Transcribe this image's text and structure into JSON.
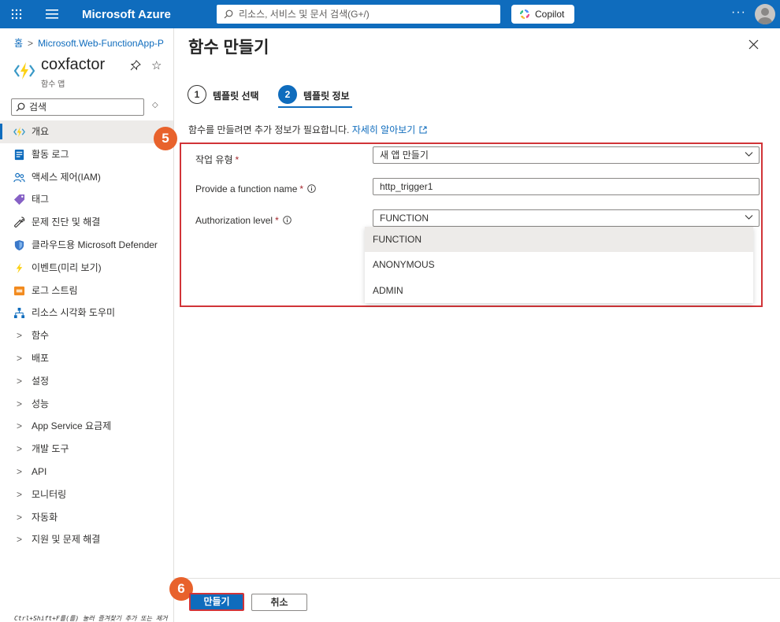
{
  "topbar": {
    "brand": "Microsoft Azure",
    "search_placeholder": "리소스, 서비스 및 문서 검색(G+/)",
    "copilot_label": "Copilot",
    "more_label": "···"
  },
  "sidebar": {
    "breadcrumb_home": "홈",
    "breadcrumb_resource": "Microsoft.Web-FunctionApp-P",
    "resource_name": "coxfactor",
    "resource_type": "함수 앱",
    "search_placeholder": "검색",
    "items": [
      {
        "label": "개요",
        "icon": "function-app-icon",
        "active": true
      },
      {
        "label": "활동 로그",
        "icon": "activity-log-icon"
      },
      {
        "label": "액세스 제어(IAM)",
        "icon": "people-icon"
      },
      {
        "label": "태그",
        "icon": "tag-icon"
      },
      {
        "label": "문제 진단 및 해결",
        "icon": "wrench-icon"
      },
      {
        "label": "클라우드용 Microsoft Defender",
        "icon": "shield-icon"
      },
      {
        "label": "이벤트(미리 보기)",
        "icon": "lightning-icon"
      },
      {
        "label": "로그 스트림",
        "icon": "log-stream-icon"
      },
      {
        "label": "리소스 시각화 도우미",
        "icon": "network-icon"
      },
      {
        "label": "함수",
        "chevron": true
      },
      {
        "label": "배포",
        "chevron": true
      },
      {
        "label": "설정",
        "chevron": true
      },
      {
        "label": "성능",
        "chevron": true
      },
      {
        "label": "App Service 요금제",
        "chevron": true
      },
      {
        "label": "개발 도구",
        "chevron": true
      },
      {
        "label": "API",
        "chevron": true
      },
      {
        "label": "모니터링",
        "chevron": true
      },
      {
        "label": "자동화",
        "chevron": true
      },
      {
        "label": "지원 및 문제 해결",
        "chevron": true
      }
    ],
    "footer_hint": "Ctrl+Shift+F를(를) 눌러 즐겨찾기 추가 또는 제거"
  },
  "panel": {
    "title": "함수 만들기",
    "steps": [
      {
        "num": "1",
        "label": "템플릿 선택"
      },
      {
        "num": "2",
        "label": "템플릿 정보"
      }
    ],
    "info_text": "함수를 만들려면 추가 정보가 필요합니다.",
    "info_link": "자세히 알아보기",
    "callout_5": "5",
    "callout_6": "6",
    "fields": {
      "task_type_label": "작업 유형",
      "task_type_value": "새 앱 만들기",
      "function_name_label": "Provide a function name",
      "function_name_value": "http_trigger1",
      "auth_level_label": "Authorization level",
      "auth_level_value": "FUNCTION",
      "required_mark": "*"
    },
    "auth_options": [
      "FUNCTION",
      "ANONYMOUS",
      "ADMIN"
    ],
    "create_button": "만들기",
    "cancel_button": "취소"
  },
  "colors": {
    "azure_blue": "#0f6cbd",
    "highlight_red": "#d13438",
    "callout_orange": "#e8622c"
  }
}
